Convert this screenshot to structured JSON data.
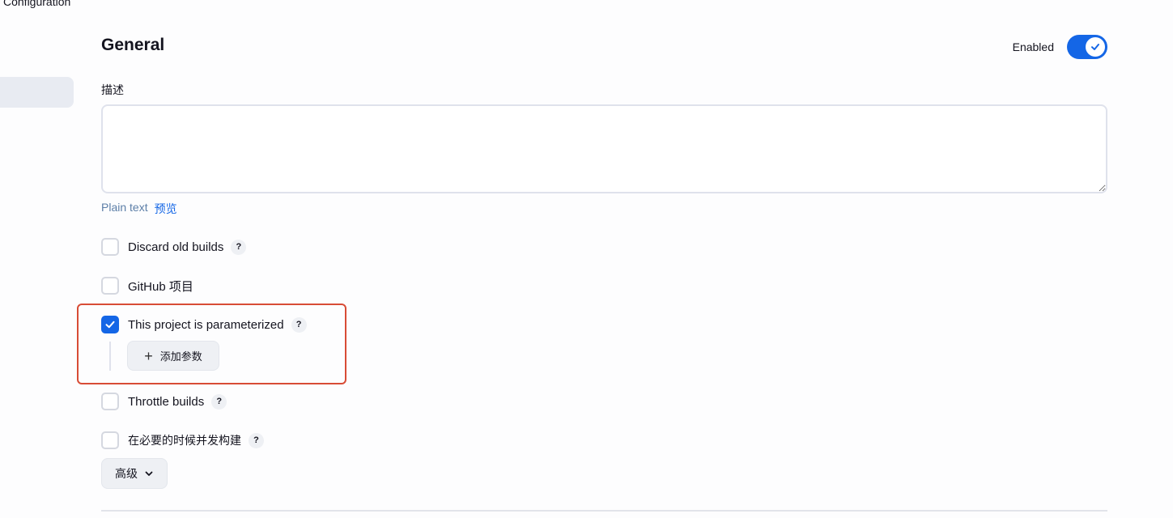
{
  "page": {
    "breadcrumb_title": "Configuration"
  },
  "general": {
    "title": "General",
    "enabled_label": "Enabled",
    "enabled": true
  },
  "description": {
    "label": "描述",
    "value": "",
    "plain_text": "Plain text",
    "preview": "预览"
  },
  "options": [
    {
      "label": "Discard old builds",
      "checked": false,
      "help": "?"
    },
    {
      "label": "GitHub 项目",
      "checked": false
    },
    {
      "label": "This project is parameterized",
      "checked": true,
      "help": "?"
    },
    {
      "label": "Throttle builds",
      "checked": false,
      "help": "?"
    },
    {
      "label": "在必要的时候并发构建",
      "checked": false,
      "help": "?"
    }
  ],
  "parameters": {
    "add_label": "添加参数"
  },
  "advanced": {
    "label": "高级"
  },
  "colors": {
    "accent": "#1466e6",
    "highlight": "#d84c36"
  }
}
